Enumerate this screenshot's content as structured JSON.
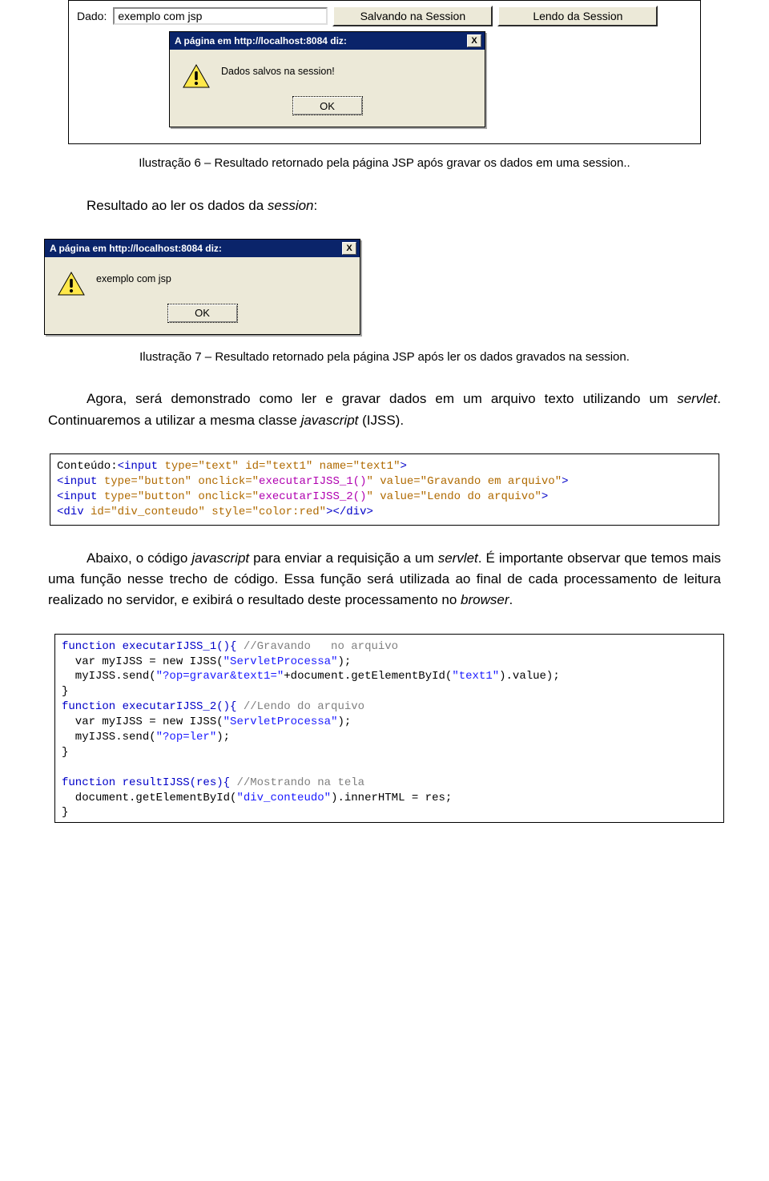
{
  "fig1": {
    "form": {
      "label": "Dado:",
      "input_value": "exemplo com jsp",
      "btn_save": "Salvando na Session",
      "btn_read": "Lendo da Session"
    },
    "dialog": {
      "title": "A página em http://localhost:8084 diz:",
      "message": "Dados salvos na session!",
      "ok": "OK",
      "close": "X"
    },
    "caption": "Ilustração 6 – Resultado retornado pela página JSP após gravar os dados em uma session.."
  },
  "para_read_header": "Resultado ao ler os dados da ",
  "para_read_header_ital": "session",
  "para_read_header_tail": ":",
  "fig2": {
    "dialog": {
      "title": "A página em http://localhost:8084 diz:",
      "message": "exemplo com jsp",
      "ok": "OK",
      "close": "X"
    },
    "caption": "Ilustração 7 – Resultado retornado pela página JSP após ler os dados gravados na session."
  },
  "para_servlet": {
    "p1_a": "Agora, será demonstrado como ler e gravar dados em um arquivo texto utilizando um ",
    "p1_i1": "servlet",
    "p1_b": ". Continuaremos a utilizar a mesma classe ",
    "p1_i2": "javascript",
    "p1_c": " (IJSS)."
  },
  "code1": {
    "l1_a": "Conteúdo:",
    "l1_b": "<input ",
    "l1_c": "type=\"text\" id=\"text1\" name=\"text1\"",
    "l1_d": ">",
    "l2_a": "<input ",
    "l2_b": "type=\"button\" onclick=\"",
    "l2_c": "executarIJSS_1()",
    "l2_d": "\" value=\"Gravando em arquivo\"",
    "l2_e": ">",
    "l3_a": "<input ",
    "l3_b": "type=\"button\" onclick=\"",
    "l3_c": "executarIJSS_2()",
    "l3_d": "\" value=\"Lendo do arquivo\"",
    "l3_e": ">",
    "l4_a": "<div ",
    "l4_b": "id=\"div_conteudo\" style=\"color:red\"",
    "l4_c": "></div>"
  },
  "para_after_code1": {
    "a": "Abaixo, o código ",
    "i1": "javascript",
    "b": " para enviar a requisição a um ",
    "i2": "servlet",
    "c": ". É importante observar que temos mais uma função nesse trecho de código. Essa função será utilizada ao final de cada processamento de leitura realizado no servidor, e exibirá o resultado deste processamento no ",
    "i3": "browser",
    "d": "."
  },
  "code2": {
    "l1": "function executarIJSS_1(){ ",
    "l1c": "//Gravando   no arquivo",
    "l2": "  var myIJSS = new IJSS(",
    "l2s": "\"ServletProcessa\"",
    "l2e": ");",
    "l3a": "  myIJSS.send(",
    "l3s": "\"?op=gravar&text1=\"",
    "l3b": "+document.getElementById(",
    "l3s2": "\"text1\"",
    "l3c": ").value);",
    "l4": "}",
    "l5": "function executarIJSS_2(){ ",
    "l5c": "//Lendo do arquivo",
    "l6": "  var myIJSS = new IJSS(",
    "l6s": "\"ServletProcessa\"",
    "l6e": ");",
    "l7a": "  myIJSS.send(",
    "l7s": "\"?op=ler\"",
    "l7b": ");",
    "l8": "}",
    "blank": "",
    "l9": "function resultIJSS(res){ ",
    "l9c": "//Mostrando na tela",
    "l10a": "  document.getElementById(",
    "l10s": "\"div_conteudo\"",
    "l10b": ").innerHTML = res;",
    "l11": "}"
  }
}
